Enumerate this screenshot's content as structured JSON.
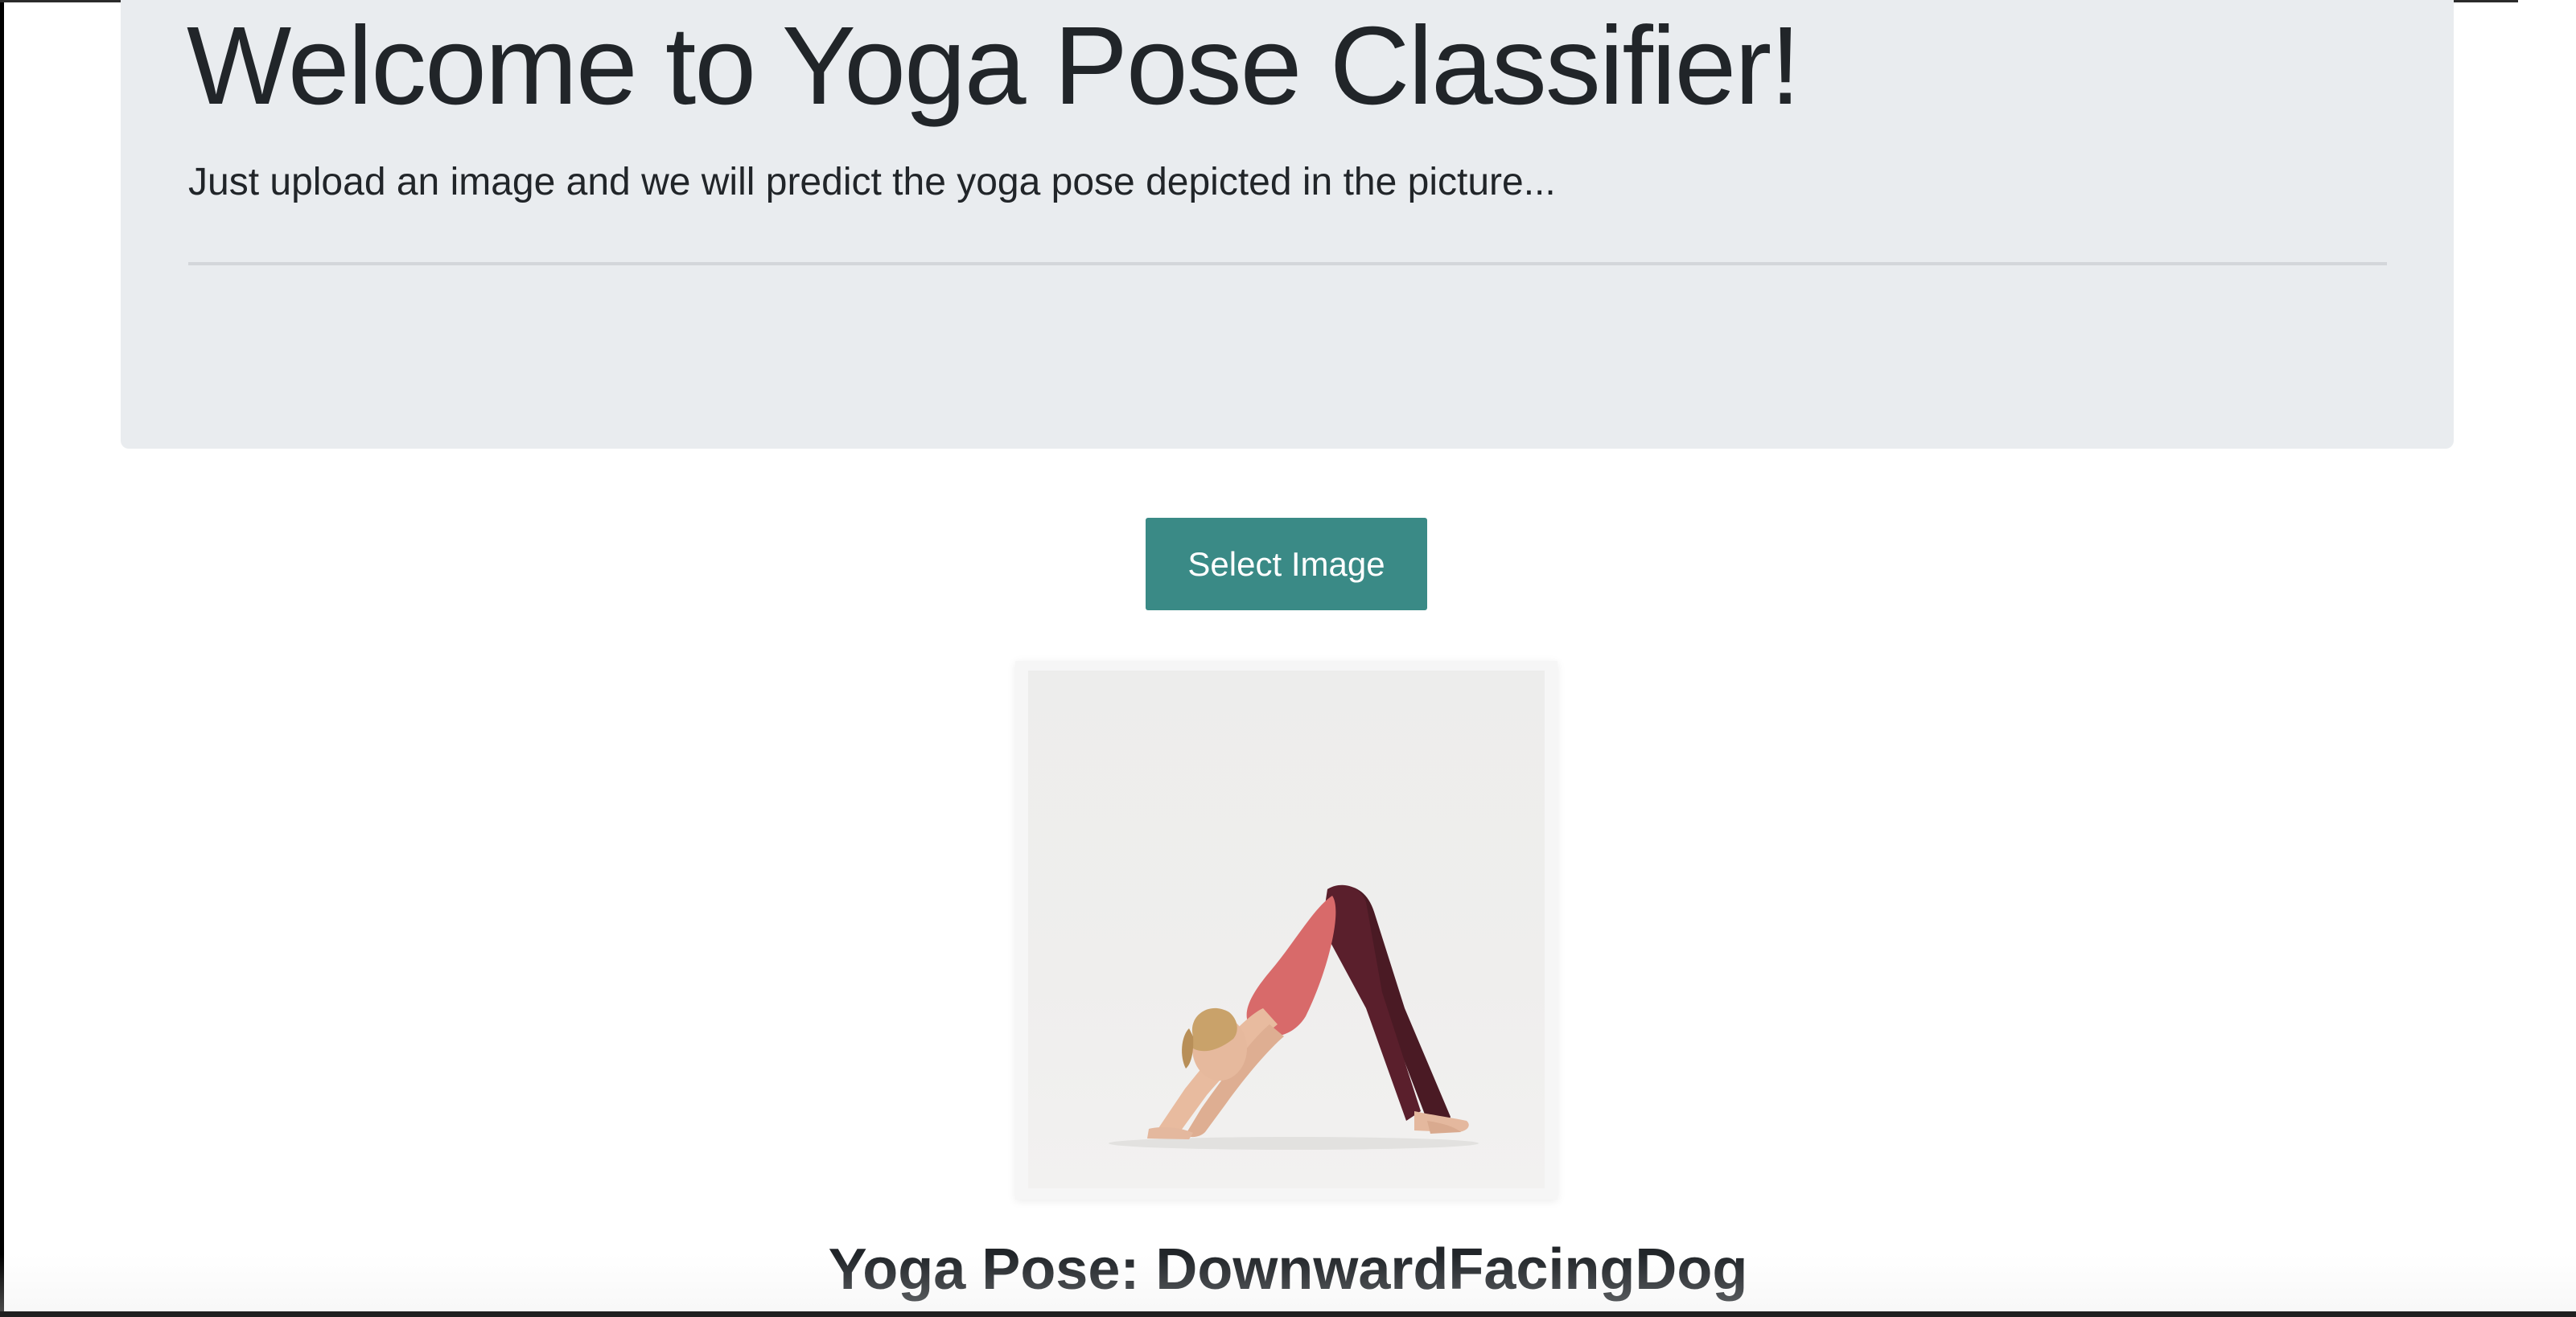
{
  "header": {
    "title": "Welcome to Yoga Pose Classifier!",
    "lead": "Just upload an image and we will predict the yoga pose depicted in the picture..."
  },
  "upload": {
    "button_label": "Select Image"
  },
  "preview": {
    "icon": "uploaded-image"
  },
  "result": {
    "text": "Yoga Pose: DownwardFacingDog"
  },
  "colors": {
    "jumbotron_bg": "#e9ecef",
    "button_bg": "#3a8a86",
    "text": "#212529"
  }
}
